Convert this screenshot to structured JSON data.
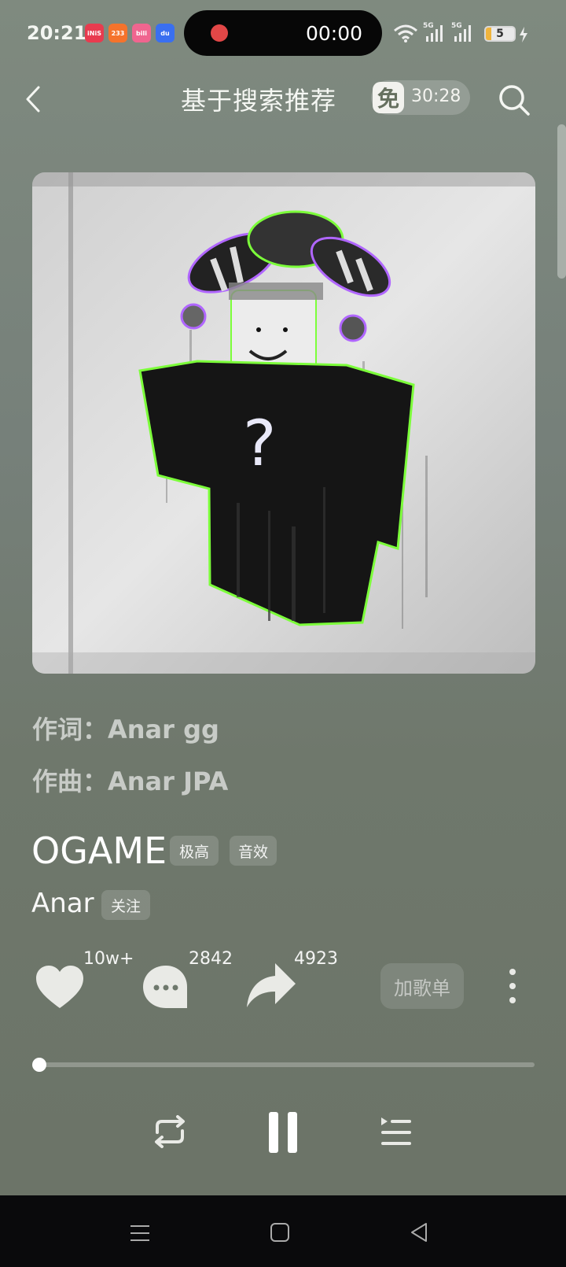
{
  "status_bar": {
    "time": "20:21",
    "app_icons": [
      {
        "name": "iqiyi-app-icon",
        "text": "iNiS",
        "color": "#e83b4f"
      },
      {
        "name": "233-app-icon",
        "text": "233",
        "color": "#f5732c"
      },
      {
        "name": "bilibili-app-icon",
        "text": "bili",
        "color": "#f0658f"
      },
      {
        "name": "baidu-app-icon",
        "text": "du",
        "color": "#3a6ff0"
      }
    ],
    "recording_time": "00:00",
    "network_5g_1": "5G",
    "network_5g_2": "5G",
    "battery_level": "5",
    "battery_fraction": 0.2
  },
  "header": {
    "title": "基于搜索推荐",
    "free_icon": "免",
    "free_time": "30:28"
  },
  "credits": {
    "lyricist": "作词：Anar gg",
    "composer": "作曲：Anar JPA"
  },
  "song": {
    "title": "OGAME",
    "tag_quality": "极高",
    "tag_effect": "音效",
    "artist": "Anar",
    "follow_label": "关注"
  },
  "actions": {
    "like_count": "10w+",
    "comment_count": "2842",
    "share_count": "4923",
    "add_playlist_label": "加歌单"
  },
  "playback": {
    "progress": 0.0,
    "state": "playing"
  },
  "colors": {
    "background": "#76807a",
    "record_dot": "#e24747",
    "album_glow": "#7cff3a"
  }
}
